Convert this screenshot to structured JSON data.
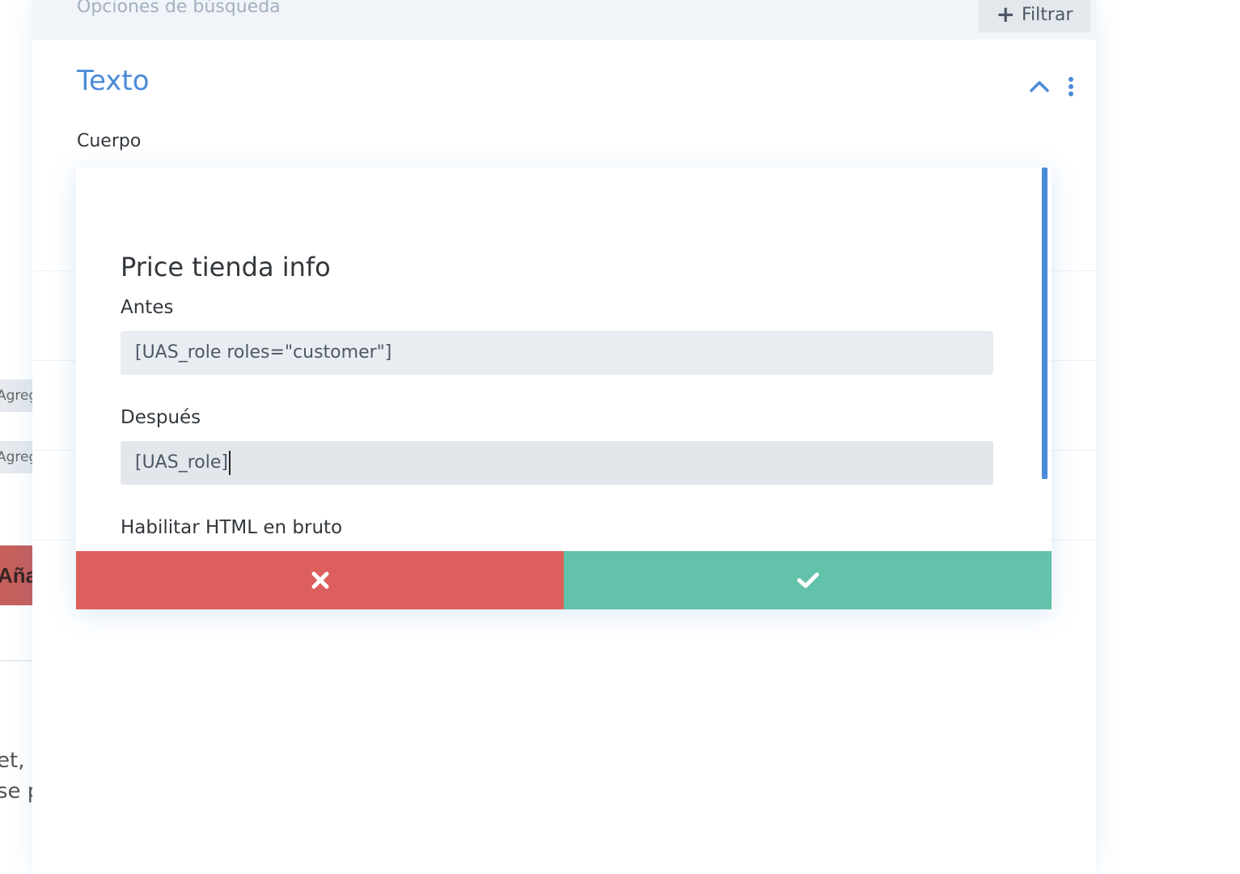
{
  "background": {
    "chip1_text": "Agregue un",
    "chip2_text": "Agregue un",
    "red_button_text": "Añadir a",
    "paragraph_line1": "et,",
    "paragraph_line2": "se p"
  },
  "panel": {
    "search_label": "Opciones de búsqueda",
    "filter_label": "Filtrar",
    "section_title": "Texto",
    "body_label": "Cuerpo"
  },
  "modal": {
    "title": "Price tienda info",
    "before_label": "Antes",
    "before_value": "[UAS_role roles=\"customer\"]",
    "after_label": "Después",
    "after_value": "[UAS_role]",
    "raw_html_label": "Habilitar HTML en bruto"
  },
  "colors": {
    "accent": "#4a8bd8",
    "cancel": "#dd5f5d",
    "confirm": "#62c2aa"
  },
  "icons": {
    "collapse": "chevron-up-icon",
    "more": "kebab-icon",
    "cancel": "close-icon",
    "confirm": "check-icon"
  }
}
